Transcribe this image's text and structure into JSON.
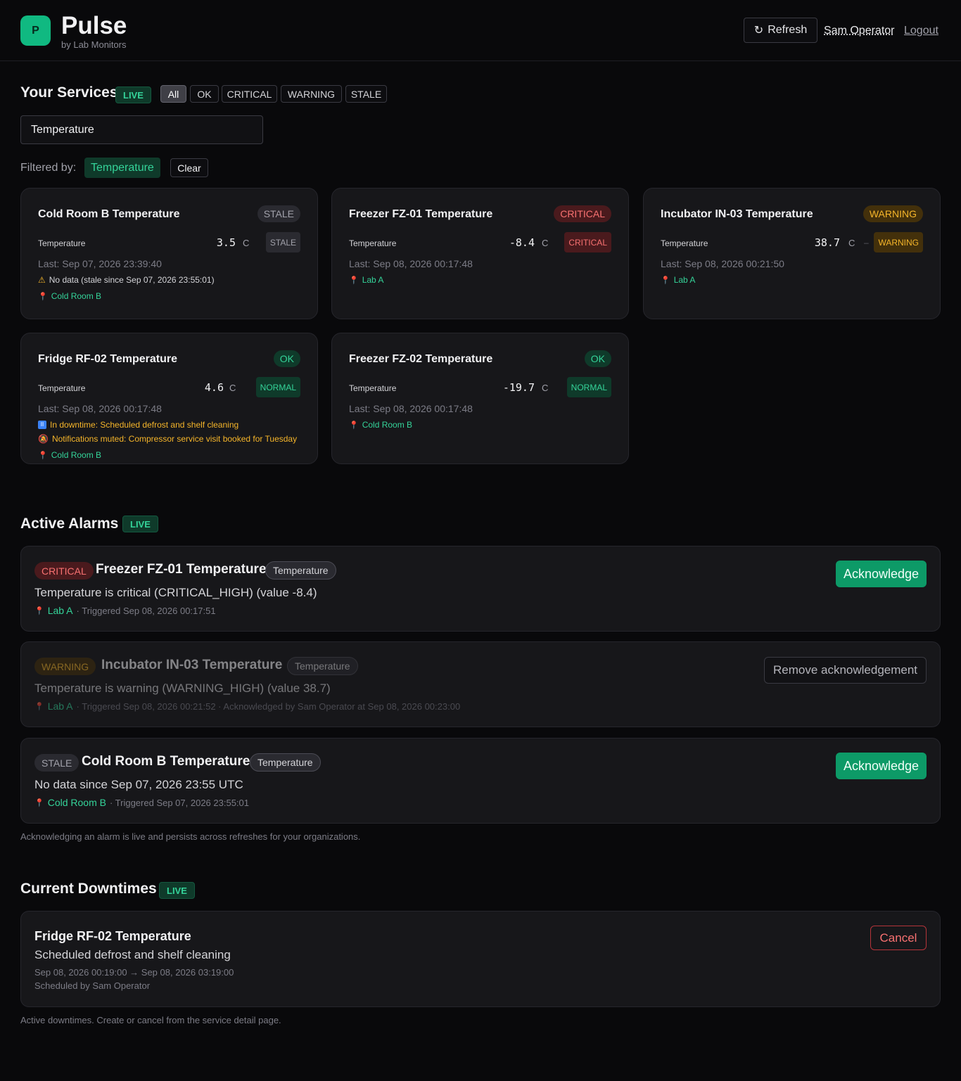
{
  "header": {
    "logo_letter": "P",
    "app_name": "Pulse",
    "app_sub": "by Lab Monitors",
    "refresh_label": "Refresh",
    "refresh_icon": "↻",
    "user_name": "Sam Operator",
    "logout_label": "Logout"
  },
  "services": {
    "title": "Your Services",
    "live_label": "LIVE",
    "filters": [
      "All",
      "OK",
      "CRITICAL",
      "WARNING",
      "STALE"
    ],
    "active_filter": "All",
    "search_value": "Temperature",
    "search_placeholder": "",
    "filtered_by_label": "Filtered by:",
    "filter_chip": "Temperature",
    "clear_label": "Clear",
    "cards": [
      {
        "title": "Cold Room B Temperature",
        "status": "STALE",
        "metric_label": "Temperature",
        "value": "3.5",
        "unit": "C",
        "metric_status": "STALE",
        "last": "Last: Sep 07, 2026 23:39:40",
        "stale_note": "No data (stale since Sep 07, 2026 23:55:01)",
        "location": "Cold Room B"
      },
      {
        "title": "Freezer FZ-01 Temperature",
        "status": "CRITICAL",
        "metric_label": "Temperature",
        "value": "-8.4",
        "unit": "C",
        "metric_status": "CRITICAL",
        "last": "Last: Sep 08, 2026 00:17:48",
        "location": "Lab A"
      },
      {
        "title": "Incubator IN-03 Temperature",
        "status": "WARNING",
        "metric_label": "Temperature",
        "value": "38.7",
        "unit": "C",
        "dash": "–",
        "metric_status": "WARNING",
        "last": "Last: Sep 08, 2026 00:21:50",
        "location": "Lab A"
      },
      {
        "title": "Fridge RF-02 Temperature",
        "status": "OK",
        "metric_label": "Temperature",
        "value": "4.6",
        "unit": "C",
        "metric_status": "NORMAL",
        "last": "Last: Sep 08, 2026 00:17:48",
        "downtime_note": "In downtime: Scheduled defrost and shelf cleaning",
        "muted_note": "Notifications muted: Compressor service visit booked for Tuesday",
        "location": "Cold Room B"
      },
      {
        "title": "Freezer FZ-02 Temperature",
        "status": "OK",
        "metric_label": "Temperature",
        "value": "-19.7",
        "unit": "C",
        "metric_status": "NORMAL",
        "last": "Last: Sep 08, 2026 00:17:48",
        "location": "Cold Room B"
      }
    ]
  },
  "alarms": {
    "title": "Active Alarms",
    "live_label": "LIVE",
    "items": [
      {
        "status": "CRITICAL",
        "title": "Freezer FZ-01 Temperature",
        "tag": "Temperature",
        "desc": "Temperature is critical (CRITICAL_HIGH) (value -8.4)",
        "location": "Lab A",
        "meta": "· Triggered Sep 08, 2026 00:17:51",
        "action": "Acknowledge"
      },
      {
        "status": "WARNING",
        "title": "Incubator IN-03 Temperature",
        "tag": "Temperature",
        "desc": "Temperature is warning (WARNING_HIGH) (value 38.7)",
        "location": "Lab A",
        "meta": "· Triggered Sep 08, 2026 00:21:52 · Acknowledged by Sam Operator at Sep 08, 2026 00:23:00",
        "action": "Remove acknowledgement"
      },
      {
        "status": "STALE",
        "title": "Cold Room B Temperature",
        "tag": "Temperature",
        "desc": "No data since Sep 07, 2026 23:55 UTC",
        "location": "Cold Room B",
        "meta": "· Triggered Sep 07, 2026 23:55:01",
        "action": "Acknowledge"
      }
    ],
    "note": "Acknowledging an alarm is live and persists across refreshes for your organizations."
  },
  "downtimes": {
    "title": "Current Downtimes",
    "live_label": "LIVE",
    "items": [
      {
        "title": "Fridge RF-02 Temperature",
        "desc": "Scheduled defrost and shelf cleaning",
        "range": "Sep 08, 2026 00:19:00 → Sep 08, 2026 03:19:00",
        "by": "Scheduled by Sam Operator",
        "action": "Cancel"
      }
    ],
    "note": "Active downtimes. Create or cancel from the service detail page."
  },
  "icons": {
    "pin": "location-pin-icon",
    "warn": "warning-triangle-icon",
    "pause": "pause-icon",
    "bell": "muted-bell-icon",
    "refresh": "refresh-icon"
  },
  "colors": {
    "accent": "#10b981",
    "critical": "#f87171",
    "warning": "#f5b52a",
    "ok": "#34d399",
    "stale": "#a1a1aa"
  }
}
